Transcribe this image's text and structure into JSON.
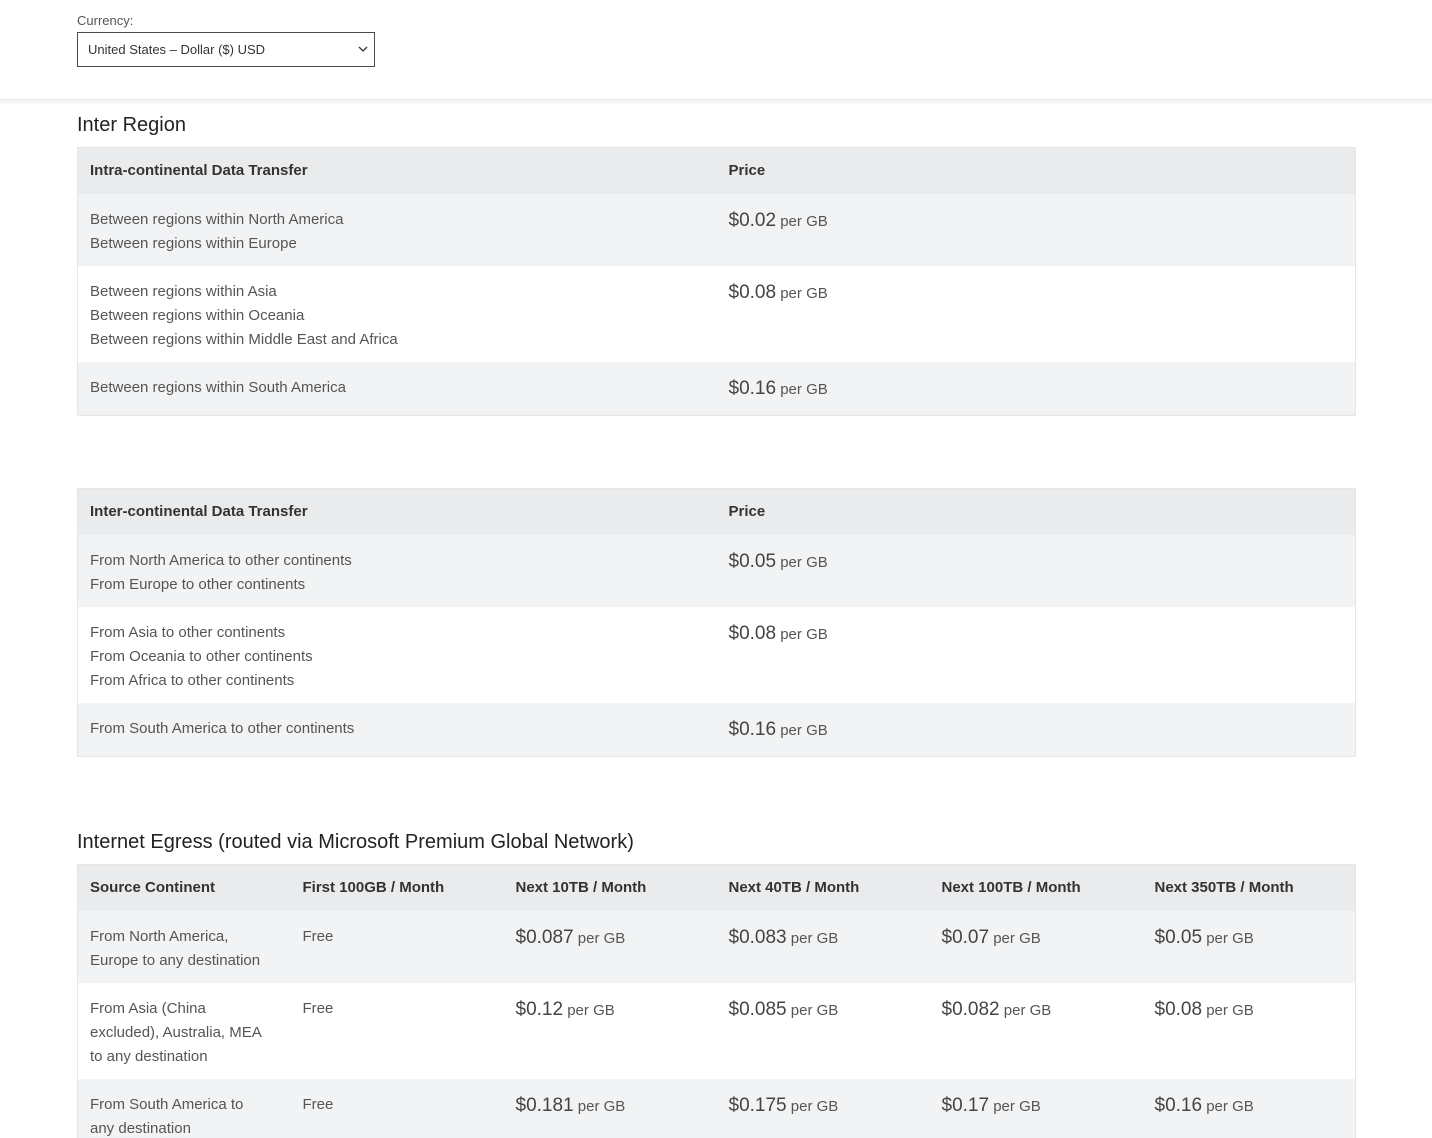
{
  "currency": {
    "label": "Currency:",
    "selected": "United States – Dollar ($) USD"
  },
  "inter_region": {
    "title": "Inter Region",
    "intra": {
      "headers": [
        "Intra-continental Data Transfer",
        "Price"
      ],
      "rows": [
        {
          "lines": [
            "Between regions within North America",
            "Between regions within Europe"
          ],
          "amount": "$0.02",
          "unit": "per GB"
        },
        {
          "lines": [
            "Between regions within Asia",
            "Between regions within Oceania",
            "Between regions within Middle East and Africa"
          ],
          "amount": "$0.08",
          "unit": "per GB"
        },
        {
          "lines": [
            "Between regions within South America"
          ],
          "amount": "$0.16",
          "unit": "per GB"
        }
      ]
    },
    "inter": {
      "headers": [
        "Inter-continental Data Transfer",
        "Price"
      ],
      "rows": [
        {
          "lines": [
            "From North America to other continents",
            "From Europe to other continents"
          ],
          "amount": "$0.05",
          "unit": "per GB"
        },
        {
          "lines": [
            "From Asia to other continents",
            "From Oceania to other continents",
            "From Africa to other continents"
          ],
          "amount": "$0.08",
          "unit": "per GB"
        },
        {
          "lines": [
            "From South America to other continents"
          ],
          "amount": "$0.16",
          "unit": "per GB"
        }
      ]
    }
  },
  "egress": {
    "title": "Internet Egress (routed via Microsoft Premium Global Network)",
    "headers": [
      "Source Continent",
      "First 100GB / Month",
      "Next 10TB / Month",
      "Next 40TB / Month",
      "Next 100TB / Month",
      "Next 350TB / Month"
    ],
    "rows": [
      {
        "source": [
          "From North America,",
          "Europe to any destination"
        ],
        "first": "Free",
        "prices": [
          "$0.087",
          "$0.083",
          "$0.07",
          "$0.05"
        ],
        "unit": "per GB"
      },
      {
        "source": [
          "From Asia (China",
          "excluded), Australia, MEA",
          "to any destination"
        ],
        "first": "Free",
        "prices": [
          "$0.12",
          "$0.085",
          "$0.082",
          "$0.08"
        ],
        "unit": "per GB"
      },
      {
        "source": [
          "From South America to",
          "any destination"
        ],
        "first": "Free",
        "prices": [
          "$0.181",
          "$0.175",
          "$0.17",
          "$0.16"
        ],
        "unit": "per GB"
      }
    ]
  }
}
